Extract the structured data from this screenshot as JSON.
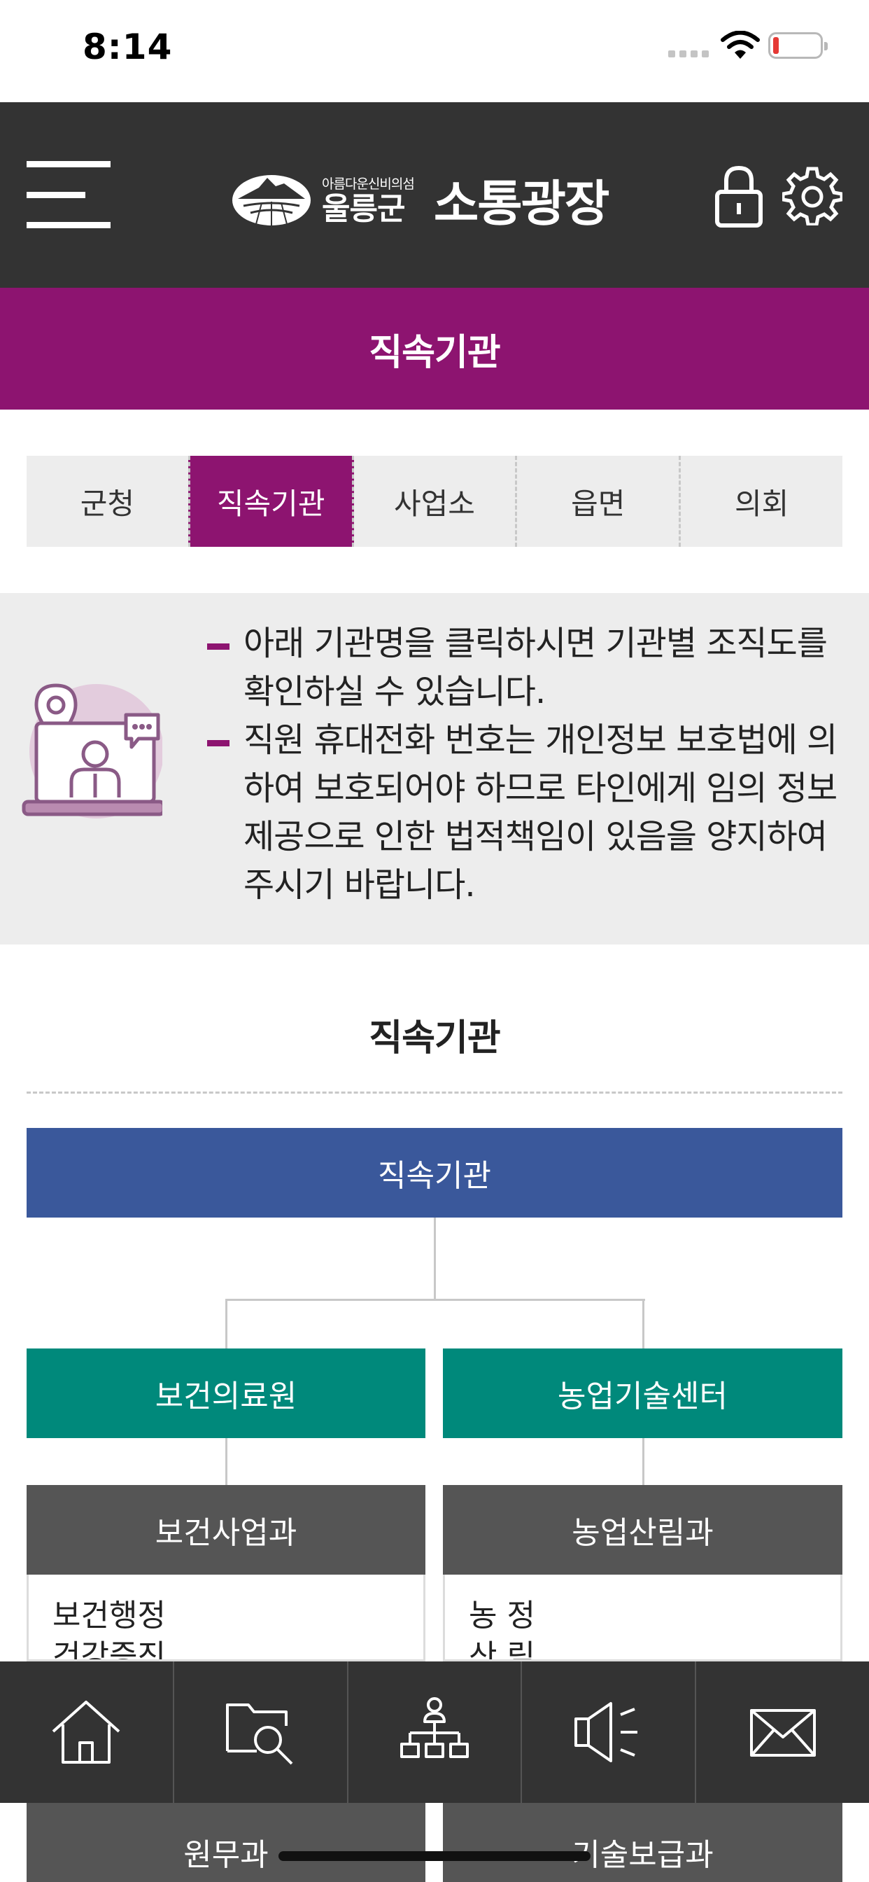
{
  "status_bar": {
    "time": "8:14"
  },
  "header": {
    "logo_slogan": "아름다운신비의섬",
    "logo_county": "울릉군",
    "logo_title": "소통광장"
  },
  "page_title": "직속기관",
  "tabs": [
    {
      "label": "군청",
      "active": false
    },
    {
      "label": "직속기관",
      "active": true
    },
    {
      "label": "사업소",
      "active": false
    },
    {
      "label": "읍면",
      "active": false
    },
    {
      "label": "의회",
      "active": false
    }
  ],
  "notice": {
    "items": [
      "아래 기관명을 클릭하시면 기관별 조직도를 확인하실 수 있습니다.",
      "직원 휴대전화 번호는 개인정보 보호법에 의하여 보호되어야 하므로 타인에게 임의 정보제공으로 인한 법적책임이 있음을 양지하여 주시기 바랍니다."
    ]
  },
  "section_heading": "직속기관",
  "org_chart": {
    "root": "직속기관",
    "branches": [
      {
        "name": "보건의료원",
        "departments": [
          {
            "name": "보건사업과",
            "teams": [
              "보건행정",
              "건강증진"
            ]
          },
          {
            "name": "원무과"
          }
        ]
      },
      {
        "name": "농업기술센터",
        "departments": [
          {
            "name": "농업산림과",
            "teams": [
              "농 정",
              "산 림"
            ]
          },
          {
            "name": "기술보급과"
          }
        ]
      }
    ]
  },
  "bottom_nav": [
    {
      "icon": "home-icon"
    },
    {
      "icon": "folder-search-icon"
    },
    {
      "icon": "org-chart-icon"
    },
    {
      "icon": "megaphone-icon"
    },
    {
      "icon": "mail-icon"
    }
  ],
  "colors": {
    "header_bg": "#333333",
    "accent": "#8d1470",
    "root_node": "#3a589b",
    "branch_node": "#00897b",
    "department_node": "#555555"
  }
}
